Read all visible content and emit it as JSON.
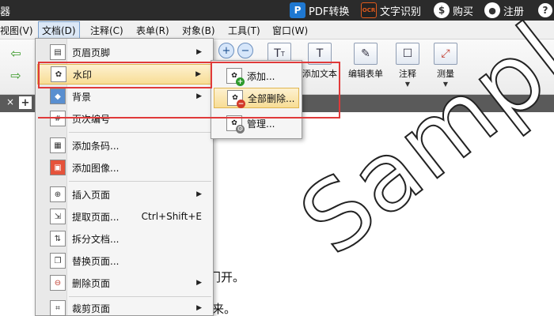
{
  "topbar": {
    "app_glyph": "器",
    "items": [
      {
        "icon": "pdf-icon",
        "label": "PDF转换"
      },
      {
        "icon": "ocr-icon",
        "badge": "OCR",
        "label": "文字识别"
      },
      {
        "icon": "buy-icon",
        "label": "购买"
      },
      {
        "icon": "user-icon",
        "label": "注册"
      },
      {
        "icon": "help-icon",
        "label": "?"
      }
    ]
  },
  "menubar": {
    "items": [
      "视图(V)",
      "文档(D)",
      "注释(C)",
      "表单(R)",
      "对象(B)",
      "工具(T)",
      "窗口(W)"
    ],
    "active": "文档(D)"
  },
  "toolbar": {
    "add_text": "添加文本",
    "edit_form": "编辑表单",
    "annotate": "注释",
    "measure": "测量",
    "caret": "▼"
  },
  "tabstrip": {
    "close": "×",
    "add": "+"
  },
  "dropdown": {
    "items": [
      {
        "label": "页眉页脚",
        "has_sub": true
      },
      {
        "label": "水印",
        "has_sub": true,
        "hover": true
      },
      {
        "label": "背景",
        "has_sub": true
      },
      {
        "label": "页次编号",
        "has_sub": false
      },
      {
        "label": "添加条码...",
        "has_sub": false
      },
      {
        "label": "添加图像...",
        "has_sub": false
      },
      {
        "label": "插入页面",
        "has_sub": true
      },
      {
        "label": "提取页面...",
        "shortcut": "Ctrl+Shift+E"
      },
      {
        "label": "拆分文档...",
        "has_sub": false
      },
      {
        "label": "替换页面...",
        "has_sub": false
      },
      {
        "label": "删除页面",
        "has_sub": true
      },
      {
        "label": "裁剪页面",
        "has_sub": true
      }
    ],
    "sub_arrow": "▶"
  },
  "submenu": {
    "items": [
      {
        "label": "添加...",
        "icon": "add-watermark-icon"
      },
      {
        "label": "全部删除...",
        "icon": "delete-all-watermark-icon",
        "hover": true
      },
      {
        "label": "管理...",
        "icon": "manage-watermark-icon"
      }
    ]
  },
  "document": {
    "line1": "门开。",
    "line2": "来。",
    "watermark": "Sample"
  },
  "colors": {
    "highlight": "#e03a3a",
    "hover_bg": "#f8dd95",
    "topbar_bg": "#2b2b2b"
  }
}
